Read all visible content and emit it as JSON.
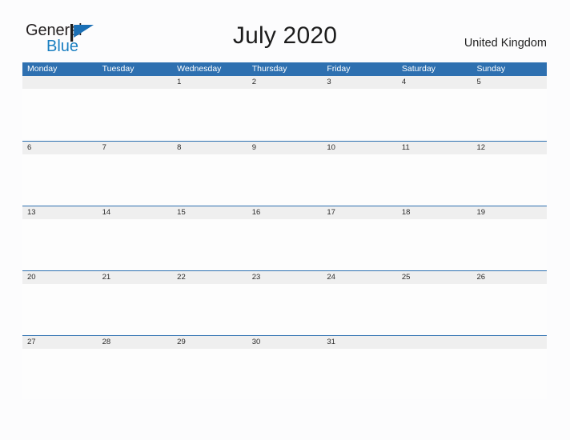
{
  "brand": {
    "name_part1": "General",
    "name_part2": "Blue",
    "flag_icon": "flag-triangle-icon",
    "colors": {
      "text_dark": "#231f20",
      "blue": "#1a7fc1"
    }
  },
  "header": {
    "title": "July 2020",
    "country": "United Kingdom"
  },
  "theme": {
    "header_blue": "#2e70b0",
    "date_band_gray": "#efefef",
    "page_background": "#fcfcfd",
    "row_rule_blue": "#2e70b0"
  },
  "calendar": {
    "month": "July",
    "year": "2020",
    "weekday_headers": [
      "Monday",
      "Tuesday",
      "Wednesday",
      "Thursday",
      "Friday",
      "Saturday",
      "Sunday"
    ],
    "weeks": [
      {
        "days": [
          "",
          "",
          "1",
          "2",
          "3",
          "4",
          "5"
        ]
      },
      {
        "days": [
          "6",
          "7",
          "8",
          "9",
          "10",
          "11",
          "12"
        ]
      },
      {
        "days": [
          "13",
          "14",
          "15",
          "16",
          "17",
          "18",
          "19"
        ]
      },
      {
        "days": [
          "20",
          "21",
          "22",
          "23",
          "24",
          "25",
          "26"
        ]
      },
      {
        "days": [
          "27",
          "28",
          "29",
          "30",
          "31",
          "",
          ""
        ]
      }
    ]
  }
}
